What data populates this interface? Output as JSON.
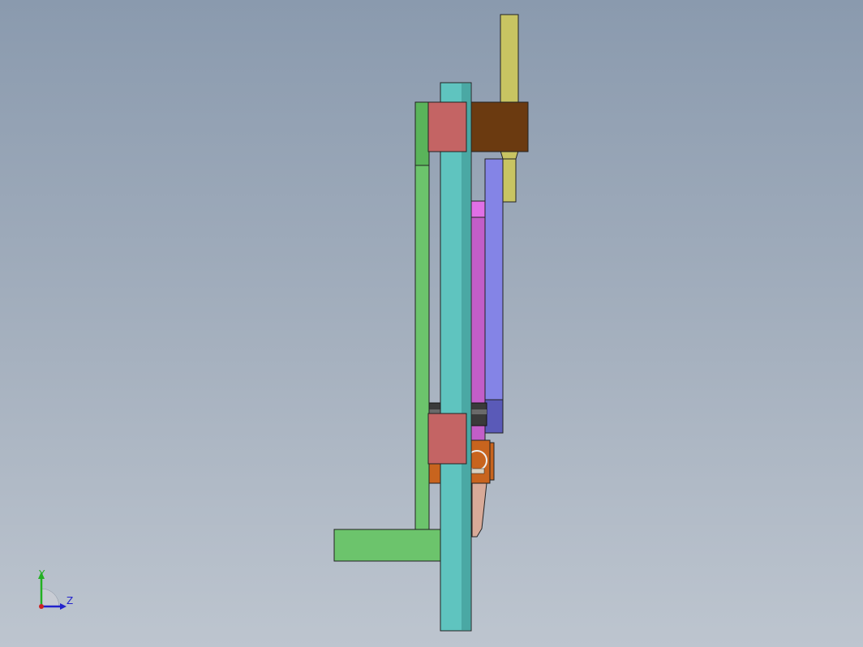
{
  "viewport": {
    "background_top": "#8a9aae",
    "background_bottom": "#bdc5cf"
  },
  "parts": [
    {
      "name": "teal-column",
      "color": "#5fc4bf"
    },
    {
      "name": "green-frame",
      "color": "#6cc46c"
    },
    {
      "name": "red-block",
      "color": "#c46464"
    },
    {
      "name": "brown-block",
      "color": "#6b3a10"
    },
    {
      "name": "olive-rod",
      "color": "#c8c462"
    },
    {
      "name": "blue-plate",
      "color": "#8484e6"
    },
    {
      "name": "magenta-plate",
      "color": "#c25ec8"
    },
    {
      "name": "dark-shaft",
      "color": "#3a3a3a"
    },
    {
      "name": "orange-bracket",
      "color": "#c8641e"
    },
    {
      "name": "tan-wedge",
      "color": "#d8aa98"
    }
  ],
  "triad": {
    "y_label": "Y",
    "z_label": "Z",
    "y_color": "#22b022",
    "z_color": "#2222cc",
    "x_color": "#cc2222"
  }
}
